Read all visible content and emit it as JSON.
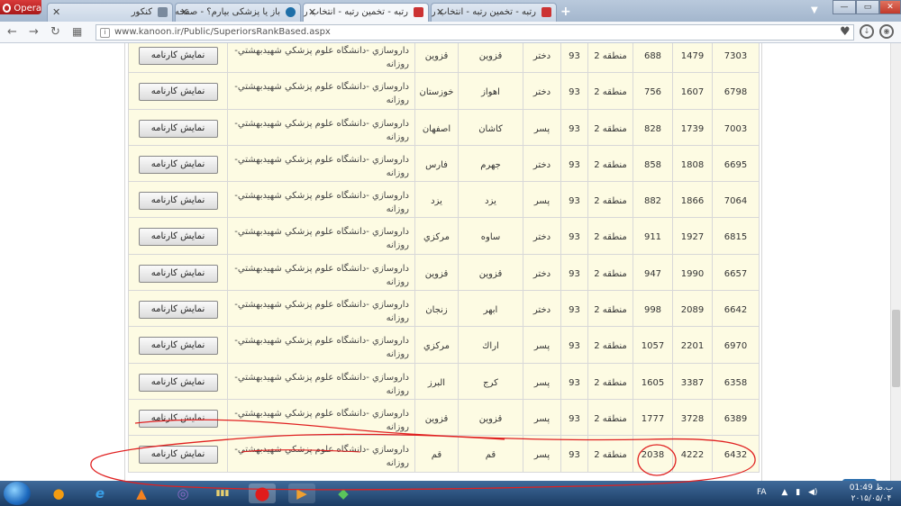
{
  "browser": {
    "opera_label": "Opera",
    "tabs": [
      {
        "title": "کنکور"
      },
      {
        "title": "باز یا پزشکی بیارم؟ - صفحه 2"
      },
      {
        "title": "رتبه - تخمین رتبه - انتخاب رشته"
      },
      {
        "title": "رتبه - تخمین رتبه - انتخاب رشته"
      }
    ],
    "url": "www.kanoon.ir/Public/SuperiorsRankBased.aspx"
  },
  "table": {
    "button_label": "نمایش کارنامه",
    "rows": [
      {
        "id": "7303",
        "rank_a": "1479",
        "rank_b": "688",
        "region": "منطقه 2",
        "year": "93",
        "gender": "دختر",
        "city": "قزوين",
        "province": "قزوين",
        "field": "داروسازي -دانشگاه علوم پزشكي شهيدبهشتي-روزانه"
      },
      {
        "id": "6798",
        "rank_a": "1607",
        "rank_b": "756",
        "region": "منطقه 2",
        "year": "93",
        "gender": "دختر",
        "city": "اهواز",
        "province": "خوزستان",
        "field": "داروسازي -دانشگاه علوم پزشكي شهيدبهشتي-روزانه"
      },
      {
        "id": "7003",
        "rank_a": "1739",
        "rank_b": "828",
        "region": "منطقه 2",
        "year": "93",
        "gender": "پسر",
        "city": "كاشان",
        "province": "اصفهان",
        "field": "داروسازي -دانشگاه علوم پزشكي شهيدبهشتي-روزانه"
      },
      {
        "id": "6695",
        "rank_a": "1808",
        "rank_b": "858",
        "region": "منطقه 2",
        "year": "93",
        "gender": "دختر",
        "city": "جهرم",
        "province": "فارس",
        "field": "داروسازي -دانشگاه علوم پزشكي شهيدبهشتي-روزانه"
      },
      {
        "id": "7064",
        "rank_a": "1866",
        "rank_b": "882",
        "region": "منطقه 2",
        "year": "93",
        "gender": "پسر",
        "city": "يزد",
        "province": "يزد",
        "field": "داروسازي -دانشگاه علوم پزشكي شهيدبهشتي-روزانه"
      },
      {
        "id": "6815",
        "rank_a": "1927",
        "rank_b": "911",
        "region": "منطقه 2",
        "year": "93",
        "gender": "دختر",
        "city": "ساوه",
        "province": "مركزي",
        "field": "داروسازي -دانشگاه علوم پزشكي شهيدبهشتي-روزانه"
      },
      {
        "id": "6657",
        "rank_a": "1990",
        "rank_b": "947",
        "region": "منطقه 2",
        "year": "93",
        "gender": "دختر",
        "city": "قزوين",
        "province": "قزوين",
        "field": "داروسازي -دانشگاه علوم پزشكي شهيدبهشتي-روزانه"
      },
      {
        "id": "6642",
        "rank_a": "2089",
        "rank_b": "998",
        "region": "منطقه 2",
        "year": "93",
        "gender": "دختر",
        "city": "ابهر",
        "province": "زنجان",
        "field": "داروسازي -دانشگاه علوم پزشكي شهيدبهشتي-روزانه"
      },
      {
        "id": "6970",
        "rank_a": "2201",
        "rank_b": "1057",
        "region": "منطقه 2",
        "year": "93",
        "gender": "پسر",
        "city": "اراك",
        "province": "مركزي",
        "field": "داروسازي -دانشگاه علوم پزشكي شهيدبهشتي-روزانه"
      },
      {
        "id": "6358",
        "rank_a": "3387",
        "rank_b": "1605",
        "region": "منطقه 2",
        "year": "93",
        "gender": "پسر",
        "city": "كرج",
        "province": "البرز",
        "field": "داروسازي -دانشگاه علوم پزشكي شهيدبهشتي-روزانه"
      },
      {
        "id": "6389",
        "rank_a": "3728",
        "rank_b": "1777",
        "region": "منطقه 2",
        "year": "93",
        "gender": "پسر",
        "city": "قزوين",
        "province": "قزوين",
        "field": "داروسازي -دانشگاه علوم پزشكي شهيدبهشتي-روزانه"
      },
      {
        "id": "6432",
        "rank_a": "4222",
        "rank_b": "2038",
        "region": "منطقه 2",
        "year": "93",
        "gender": "پسر",
        "city": "قم",
        "province": "قم",
        "field": "داروسازي -دانشگاه علوم پزشكي شهيدبهشتي-روزانه"
      }
    ]
  },
  "taskbar": {
    "lang": "FA",
    "time": "01:49 ب.ظ",
    "date": "۲۰۱۵/۰۵/۰۴"
  },
  "colors": {
    "row_bg": "#fdfbe3",
    "scroll_top_btn": "#2d6fad",
    "annotation": "#e02020"
  },
  "icons": {
    "scroll_top": "chevron-up-icon",
    "back": "back-arrow-icon",
    "forward": "forward-arrow-icon",
    "reload": "reload-icon"
  }
}
